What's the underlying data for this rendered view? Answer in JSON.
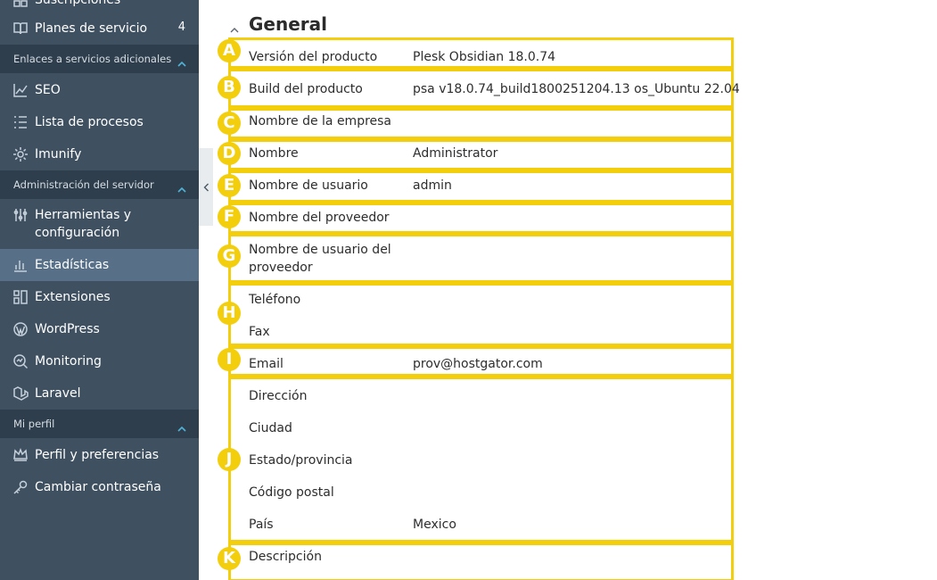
{
  "sidebar": {
    "items_top": [
      {
        "label": "Suscripciones",
        "icon": "grid-icon"
      },
      {
        "label": "Planes de servicio",
        "badge": "4",
        "icon": "book-icon"
      }
    ],
    "section_additional": {
      "title": "Enlaces a servicios adicionales"
    },
    "items_additional": [
      {
        "label": "SEO",
        "icon": "chart-line-icon"
      },
      {
        "label": "Lista de procesos",
        "icon": "list-icon"
      },
      {
        "label": "Imunify",
        "icon": "gear-icon"
      }
    ],
    "section_server": {
      "title": "Administración del servidor"
    },
    "items_server": [
      {
        "label": "Herramientas y configuración",
        "icon": "sliders-icon"
      },
      {
        "label": "Estadísticas",
        "icon": "bar-chart-icon",
        "active": true
      },
      {
        "label": "Extensiones",
        "icon": "extensions-icon"
      },
      {
        "label": "WordPress",
        "icon": "wordpress-icon"
      },
      {
        "label": "Monitoring",
        "icon": "monitoring-icon"
      },
      {
        "label": "Laravel",
        "icon": "laravel-icon"
      }
    ],
    "section_profile": {
      "title": "Mi perfil"
    },
    "items_profile": [
      {
        "label": "Perfil y preferencias",
        "icon": "crown-icon"
      },
      {
        "label": "Cambiar contraseña",
        "icon": "key-icon"
      }
    ]
  },
  "main": {
    "heading": "General",
    "rows": {
      "version": {
        "label": "Versión del producto",
        "value": "Plesk Obsidian 18.0.74"
      },
      "build": {
        "label": "Build del producto",
        "value": "psa v18.0.74_build1800251204.13 os_Ubuntu 22.04"
      },
      "company": {
        "label": "Nombre de la empresa",
        "value": ""
      },
      "name": {
        "label": "Nombre",
        "value": "Administrator"
      },
      "username": {
        "label": "Nombre de usuario",
        "value": "admin"
      },
      "provider": {
        "label": "Nombre del proveedor",
        "value": ""
      },
      "provider_username": {
        "label": "Nombre de usuario del proveedor",
        "value": ""
      },
      "phone": {
        "label": "Teléfono",
        "value": ""
      },
      "fax": {
        "label": "Fax",
        "value": ""
      },
      "email": {
        "label": "Email",
        "value": "prov@hostgator.com"
      },
      "address": {
        "label": "Dirección",
        "value": ""
      },
      "city": {
        "label": "Ciudad",
        "value": ""
      },
      "state": {
        "label": "Estado/provincia",
        "value": ""
      },
      "zip": {
        "label": "Código postal",
        "value": ""
      },
      "country": {
        "label": "País",
        "value": "Mexico"
      },
      "description": {
        "label": "Descripción",
        "value": ""
      }
    },
    "markers": [
      "A",
      "B",
      "C",
      "D",
      "E",
      "F",
      "G",
      "H",
      "I",
      "J",
      "K"
    ],
    "highlight_color": "#f3ce0d"
  },
  "colors": {
    "sidebar_bg": "#3f5061",
    "sidebar_section_bg": "#2f3e4c",
    "sidebar_active_bg": "#577087",
    "accent": "#4fb4d8"
  }
}
